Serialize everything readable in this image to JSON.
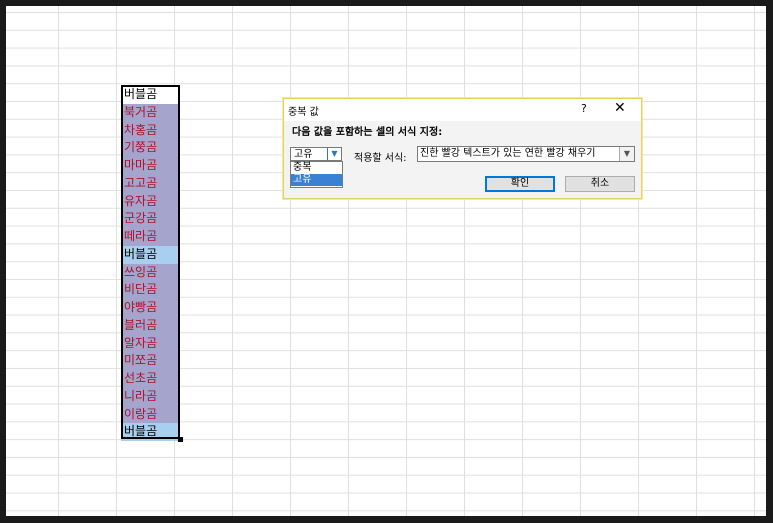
{
  "column": {
    "cells": [
      {
        "text": "버블곰",
        "style": "uniq-first"
      },
      {
        "text": "북거곰",
        "style": "dup"
      },
      {
        "text": "차홍곰",
        "style": "dup"
      },
      {
        "text": "기쭝곰",
        "style": "dup"
      },
      {
        "text": "마마곰",
        "style": "dup"
      },
      {
        "text": "고고곰",
        "style": "dup"
      },
      {
        "text": "유자곰",
        "style": "dup"
      },
      {
        "text": "군강곰",
        "style": "dup"
      },
      {
        "text": "떼라곰",
        "style": "dup"
      },
      {
        "text": "버블곰",
        "style": "uniq"
      },
      {
        "text": "쓰잉곰",
        "style": "dup"
      },
      {
        "text": "비단곰",
        "style": "dup"
      },
      {
        "text": "야빵곰",
        "style": "dup"
      },
      {
        "text": "블러곰",
        "style": "dup"
      },
      {
        "text": "알자곰",
        "style": "dup"
      },
      {
        "text": "미쪼곰",
        "style": "dup"
      },
      {
        "text": "선초곰",
        "style": "dup"
      },
      {
        "text": "니라곰",
        "style": "dup"
      },
      {
        "text": "이랑곰",
        "style": "dup"
      },
      {
        "text": "버블곰",
        "style": "uniq"
      }
    ]
  },
  "dialog": {
    "title": "중복 값",
    "help": "?",
    "close": "✕",
    "prompt": "다음 값을 포함하는 셀의 서식 지정:",
    "type_value": "고유",
    "type_options": [
      "중복",
      "고유"
    ],
    "format_label": "적용할 서식:",
    "format_value": "진한 빨강 텍스트가 있는 연한 빨강 채우기",
    "ok": "확인",
    "cancel": "취소"
  },
  "colors": {
    "duplicate_fill": "#a4a4cc",
    "duplicate_text": "#b0102a",
    "unique_fill": "#a8cff0"
  }
}
